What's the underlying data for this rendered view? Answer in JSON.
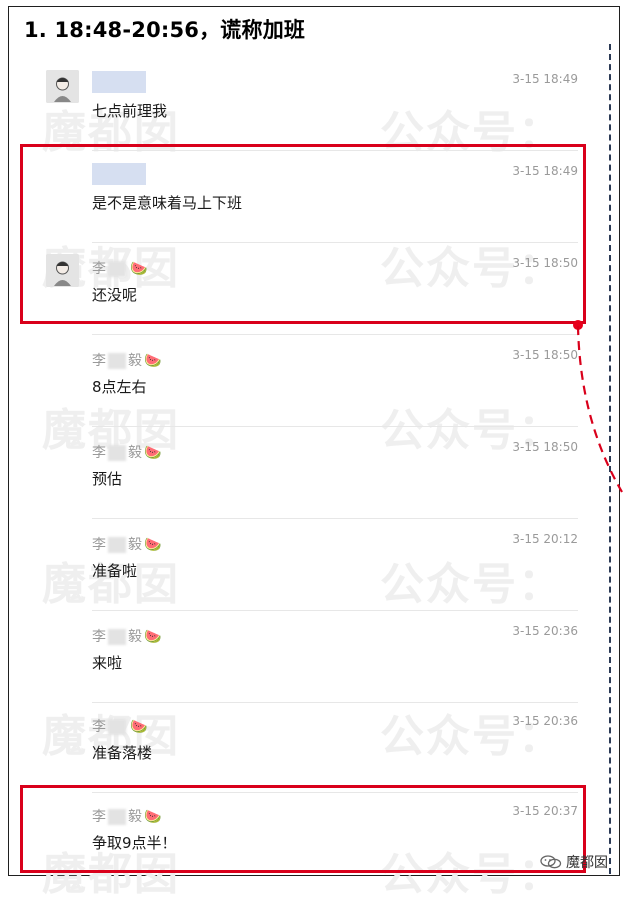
{
  "title": "1. 18:48-20:56，谎称加班",
  "watermark_left": "魔都囡",
  "watermark_right": "公众号：",
  "footer": {
    "brand": "魔都囡"
  },
  "messages": [
    {
      "name": "",
      "name_prefix": "",
      "name_suffix": "",
      "time": "3-15 18:49",
      "content": "七点前理我",
      "avatar": true,
      "blank_name": true
    },
    {
      "name": "",
      "name_prefix": "",
      "name_suffix": "",
      "time": "3-15 18:49",
      "content": "是不是意味着马上下班",
      "avatar": false,
      "blank_name": true
    },
    {
      "name_prefix": "李",
      "name_suffix": "",
      "time": "3-15 18:50",
      "content": "还没呢",
      "avatar": true,
      "blank_name": false
    },
    {
      "name_prefix": "李",
      "name_suffix": "毅",
      "time": "3-15 18:50",
      "content": "8点左右",
      "avatar": false,
      "blank_name": false
    },
    {
      "name_prefix": "李",
      "name_suffix": "毅",
      "time": "3-15 18:50",
      "content": "预估",
      "avatar": false,
      "blank_name": false
    },
    {
      "name_prefix": "李",
      "name_suffix": "毅",
      "time": "3-15 20:12",
      "content": "准备啦",
      "avatar": false,
      "blank_name": false
    },
    {
      "name_prefix": "李",
      "name_suffix": "毅",
      "time": "3-15 20:36",
      "content": "来啦",
      "avatar": false,
      "blank_name": false
    },
    {
      "name_prefix": "李",
      "name_suffix": "",
      "time": "3-15 20:36",
      "content": "准备落楼",
      "avatar": false,
      "blank_name": false
    },
    {
      "name_prefix": "李",
      "name_suffix": "毅",
      "time": "3-15 20:37",
      "content": "争取9点半！",
      "avatar": false,
      "blank_name": false
    }
  ],
  "emoji": "🍉",
  "colors": {
    "highlight": "#d9001b",
    "dashed_line": "#2b3a55",
    "name_placeholder": "#d6dff1"
  }
}
